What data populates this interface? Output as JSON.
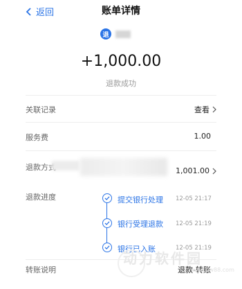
{
  "header": {
    "back_label": "返回",
    "title": "账单详情"
  },
  "merchant": {
    "icon_text": "退",
    "icon_name": "refund-icon"
  },
  "amount": "+1,000.00",
  "status": "退款成功",
  "rows": {
    "related": {
      "label": "关联记录",
      "value": "查看"
    },
    "fee": {
      "label": "服务费",
      "value": "1.00"
    },
    "method": {
      "label": "退款方式",
      "value": "1,001.00"
    },
    "progress_label": "退款进度",
    "transfer": {
      "label": "转账说明",
      "value": "退款-转账"
    }
  },
  "timeline": [
    {
      "step": "提交银行处理",
      "time": "12-05 21:17"
    },
    {
      "step": "银行受理退款",
      "time": "12-05 21:19"
    },
    {
      "step": "银行已入账",
      "time": "12-05 21:19"
    }
  ],
  "watermark": {
    "text": "动力软件园",
    "url": "www.pw88.com"
  },
  "colors": {
    "accent": "#2b74e6",
    "muted": "#9a9a9a",
    "divider": "#ededed"
  }
}
